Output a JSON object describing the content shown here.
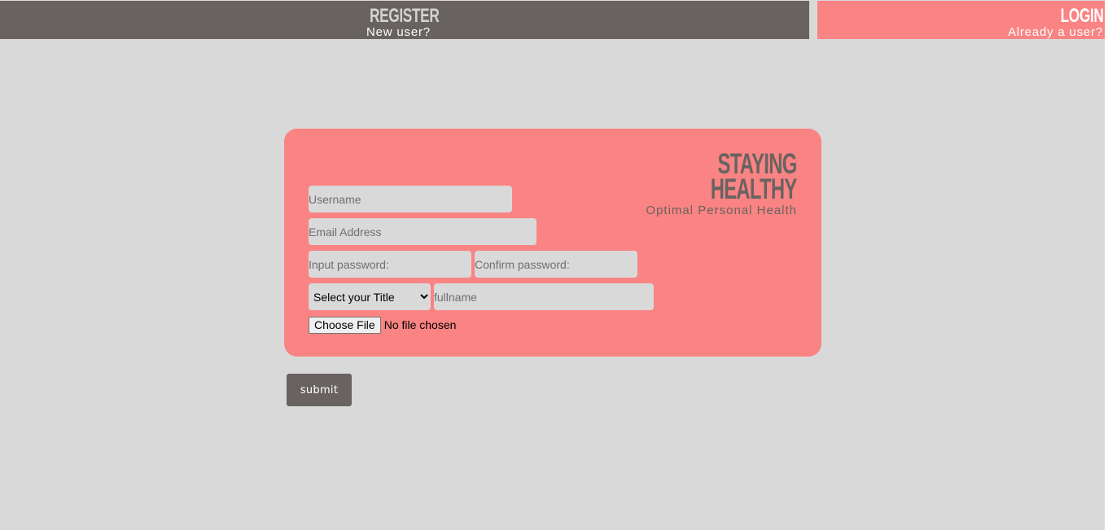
{
  "nav": {
    "register": {
      "title": "REGISTER",
      "subtitle": "New user?"
    },
    "login": {
      "title": "LOGIN",
      "subtitle": "Already a user?"
    }
  },
  "brand": {
    "line1": "STAYING",
    "line2": "HEALTHY",
    "tagline": "Optimal Personal Health"
  },
  "form": {
    "username_placeholder": "Username",
    "email_placeholder": "Email Address",
    "password_placeholder": "Input password:",
    "confirm_placeholder": "Confirm password:",
    "title_select": {
      "selected": "Select your Title"
    },
    "fullname_placeholder": "fullname",
    "file": {
      "button_label": "Choose File",
      "status": "No file chosen"
    },
    "submit_label": "submit"
  },
  "colors": {
    "background": "#d9d9d9",
    "dark": "#686361",
    "accent": "#fa8383",
    "field": "#d9d9d9"
  }
}
